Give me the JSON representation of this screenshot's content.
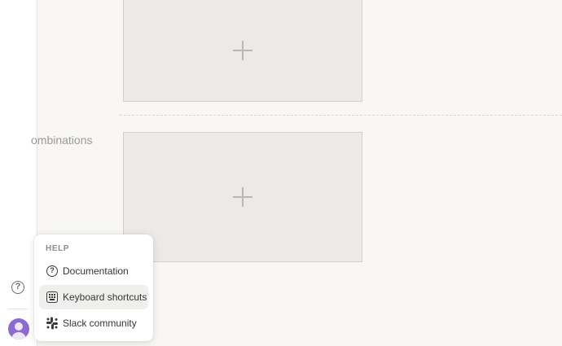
{
  "section": {
    "label": "ombinations"
  },
  "help_menu": {
    "heading": "HELP",
    "items": [
      {
        "label": "Documentation",
        "icon": "question-circle-icon"
      },
      {
        "label": "Keyboard shortcuts",
        "icon": "keyboard-icon"
      },
      {
        "label": "Slack community",
        "icon": "slack-icon"
      }
    ]
  },
  "sidebar": {
    "help_glyph": "?"
  },
  "colors": {
    "avatar": "#8b6bd1",
    "background": "#f8f7f5",
    "slot": "#ebeae8"
  }
}
